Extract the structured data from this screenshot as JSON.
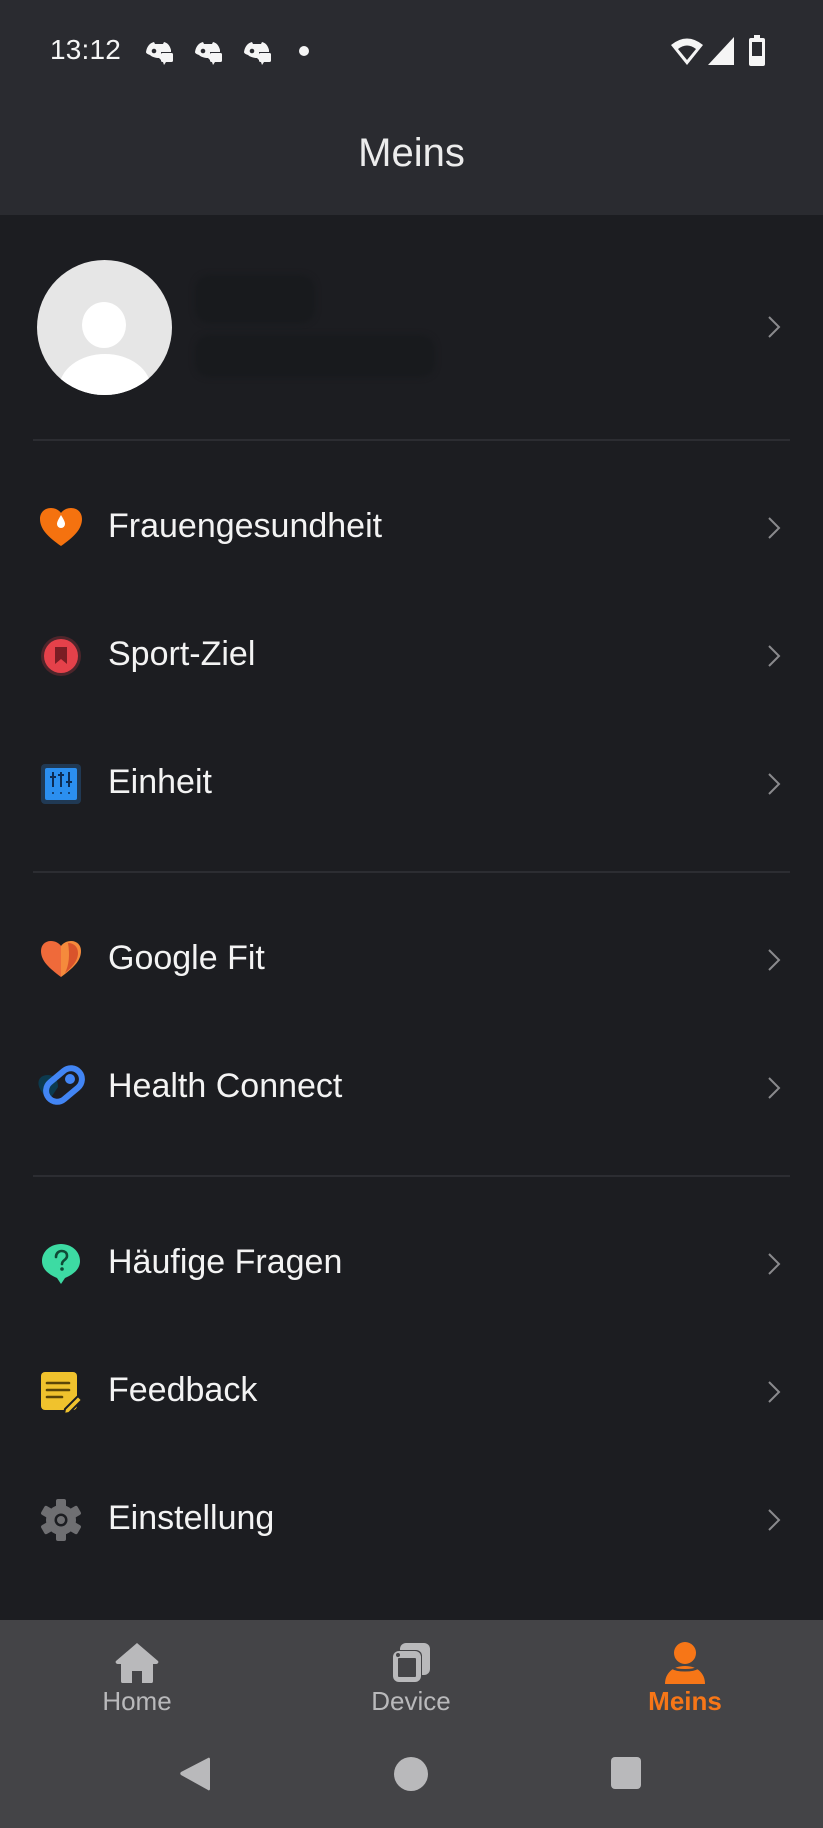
{
  "status_bar": {
    "time": "13:12",
    "notification_icons": [
      "discord-icon",
      "discord-icon",
      "discord-icon",
      "dot-icon"
    ],
    "system_icons": [
      "wifi-icon",
      "cellular-signal-icon",
      "battery-icon"
    ]
  },
  "header": {
    "title": "Meins"
  },
  "profile": {
    "name": "",
    "subtitle": "",
    "avatar_icon": "default-avatar-icon"
  },
  "menu_groups": [
    {
      "items": [
        {
          "label": "Frauengesundheit",
          "icon": "heart-drop-icon",
          "color": "#f5720f"
        },
        {
          "label": "Sport-Ziel",
          "icon": "bookmark-badge-icon",
          "color": "#e5414a"
        },
        {
          "label": "Einheit",
          "icon": "sliders-icon",
          "color": "#2b8ff0"
        }
      ]
    },
    {
      "items": [
        {
          "label": "Google Fit",
          "icon": "google-fit-heart-icon",
          "color": "#ef6a3a"
        },
        {
          "label": "Health Connect",
          "icon": "health-connect-icon",
          "color": "#4285f4"
        }
      ]
    },
    {
      "items": [
        {
          "label": "Häufige Fragen",
          "icon": "question-bubble-icon",
          "color": "#3ddba3"
        },
        {
          "label": "Feedback",
          "icon": "note-edit-icon",
          "color": "#f0c22d"
        },
        {
          "label": "Einstellung",
          "icon": "gear-icon",
          "color": "#6f6f72"
        }
      ]
    }
  ],
  "bottom_nav": {
    "items": [
      {
        "label": "Home",
        "icon": "home-icon",
        "active": false
      },
      {
        "label": "Device",
        "icon": "device-icon",
        "active": false
      },
      {
        "label": "Meins",
        "icon": "person-icon",
        "active": true
      }
    ],
    "active_color": "#f77617",
    "inactive_color": "#b9b9bb"
  },
  "system_nav": {
    "buttons": [
      "back",
      "home",
      "recents"
    ]
  }
}
